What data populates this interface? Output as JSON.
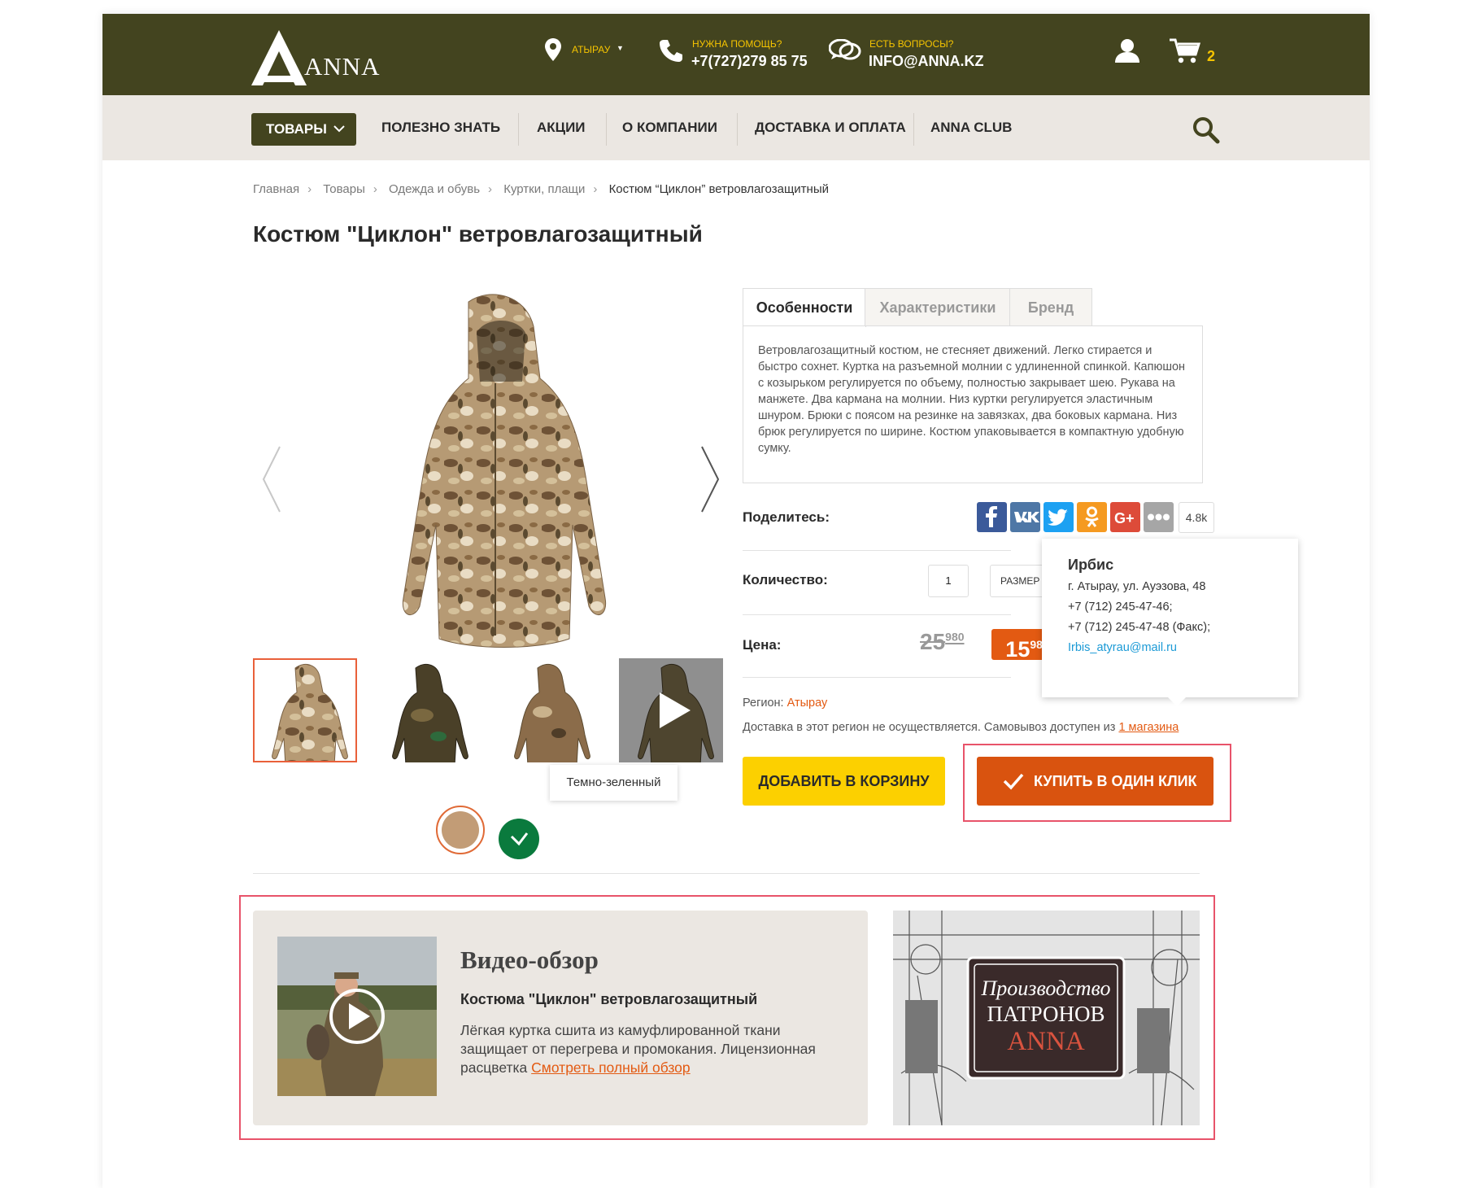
{
  "header": {
    "logo_text": "ANNA",
    "location": "АТЫРАУ",
    "help_label": "НУЖНА ПОМОЩЬ?",
    "phone": "+7(727)279 85 75",
    "questions_label": "ЕСТЬ ВОПРОСЫ?",
    "email": "INFO@ANNA.KZ",
    "cart_count": "2",
    "colors": {
      "bar": "#43441f",
      "accent": "#f6c400"
    }
  },
  "nav": {
    "products": "ТОВАРЫ",
    "items": [
      "ПОЛЕЗНО ЗНАТЬ",
      "АКЦИИ",
      "О КОМПАНИИ",
      "ДОСТАВКА И ОПЛАТА",
      "ANNA CLUB"
    ]
  },
  "breadcrumb": [
    "Главная",
    "Товары",
    "Одежда и обувь",
    "Куртки, плащи",
    "Костюм “Циклон” ветровлагозащитный"
  ],
  "product": {
    "title": "Костюм \"Циклон\" ветровлагозащитный",
    "tabs": [
      "Особенности",
      "Характеристики",
      "Бренд"
    ],
    "description": "Ветровлагозащитный костюм, не стесняет движений. Легко стирается и быстро сохнет. Куртка на разъемной молнии с удлиненной спинкой. Капюшон с козырьком регулируется по объему, полностью закрывает шею. Рукава на манжете. Два кармана на молнии. Низ куртки регулируется эластичным шнуром. Брюки с поясом на резинке на завязках, два боковых кармана. Низ брюк регулируется по ширине. Костюм упаковывается в компактную удобную сумку.",
    "color_tooltip": "Темно-зеленный",
    "swatch_colors": [
      "#c29c76",
      "#0a7a3d"
    ]
  },
  "share": {
    "label": "Поделитесь:",
    "count": "4.8k",
    "buttons": [
      "facebook-icon",
      "vk-icon",
      "twitter-icon",
      "odnoklassniki-icon",
      "google-plus-icon",
      "more-icon"
    ]
  },
  "purchase": {
    "quantity_label": "Количество:",
    "quantity_value": "1",
    "size_placeholder": "РАЗМЕР",
    "price_label": "Цена:",
    "old_price_main": "25",
    "old_price_sup": "980",
    "new_price_main": "15",
    "new_price_sup": "980",
    "region_label": "Регион:",
    "region_value": "Атырау",
    "delivery_text": "Доставка в этот регион не осуществляется. Самовывоз доступен из",
    "delivery_link": "1 магазина",
    "add_to_cart": "ДОБАВИТЬ В КОРЗИНУ",
    "one_click": "КУПИТЬ В ОДИН КЛИК"
  },
  "store_popup": {
    "name": "Ирбис",
    "address": "г. Атырау, ул. Ауэзова, 48",
    "phone1": "+7 (712) 245-47-46;",
    "phone2": "+7 (712) 245-47-48 (Факс);",
    "email": "Irbis_atyrau@mail.ru"
  },
  "review": {
    "title": "Видео-обзор",
    "subtitle": "Костюма \"Циклон\" ветровлагозащитный",
    "text": "Лёгкая куртка сшита из камуфлированной ткани защищает от перегрева и промокания. Лицензионная расцветка",
    "link": "Смотреть полный обзор"
  },
  "banner": {
    "line1": "Производство",
    "line2": "ПАТРОНОВ",
    "line3": "ANNA"
  }
}
